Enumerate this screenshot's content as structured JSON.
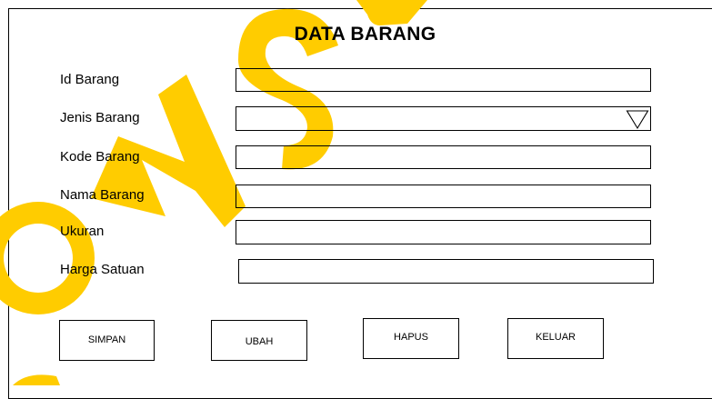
{
  "form": {
    "title": "DATA BARANG",
    "fields": [
      {
        "label": "Id Barang",
        "value": ""
      },
      {
        "label": "Jenis Barang",
        "value": ""
      },
      {
        "label": "Kode Barang",
        "value": ""
      },
      {
        "label": "Nama Barang",
        "value": ""
      },
      {
        "label": "Ukuran",
        "value": ""
      },
      {
        "label": "Harga Satuan",
        "value": ""
      }
    ],
    "buttons": {
      "simpan": "SIMPAN",
      "ubah": "UBAH",
      "hapus": "HAPUS",
      "keluar": "KELUAR"
    }
  },
  "icons": {
    "dropdown": "triangle-down-icon"
  },
  "colors": {
    "watermark": "#FFCC00"
  }
}
